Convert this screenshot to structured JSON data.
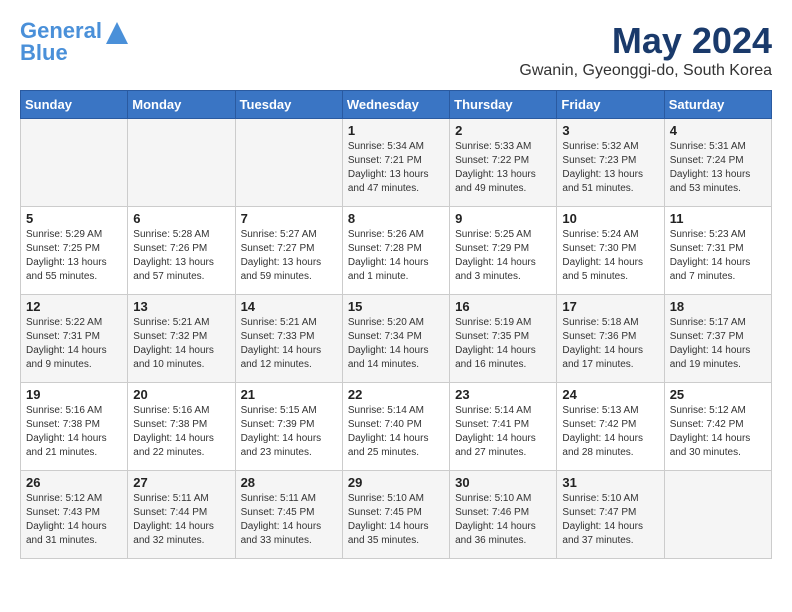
{
  "header": {
    "logo_line1": "General",
    "logo_line2": "Blue",
    "month": "May 2024",
    "location": "Gwanin, Gyeonggi-do, South Korea"
  },
  "days_of_week": [
    "Sunday",
    "Monday",
    "Tuesday",
    "Wednesday",
    "Thursday",
    "Friday",
    "Saturday"
  ],
  "weeks": [
    [
      {
        "day": "",
        "content": ""
      },
      {
        "day": "",
        "content": ""
      },
      {
        "day": "",
        "content": ""
      },
      {
        "day": "1",
        "content": "Sunrise: 5:34 AM\nSunset: 7:21 PM\nDaylight: 13 hours and 47 minutes."
      },
      {
        "day": "2",
        "content": "Sunrise: 5:33 AM\nSunset: 7:22 PM\nDaylight: 13 hours and 49 minutes."
      },
      {
        "day": "3",
        "content": "Sunrise: 5:32 AM\nSunset: 7:23 PM\nDaylight: 13 hours and 51 minutes."
      },
      {
        "day": "4",
        "content": "Sunrise: 5:31 AM\nSunset: 7:24 PM\nDaylight: 13 hours and 53 minutes."
      }
    ],
    [
      {
        "day": "5",
        "content": "Sunrise: 5:29 AM\nSunset: 7:25 PM\nDaylight: 13 hours and 55 minutes."
      },
      {
        "day": "6",
        "content": "Sunrise: 5:28 AM\nSunset: 7:26 PM\nDaylight: 13 hours and 57 minutes."
      },
      {
        "day": "7",
        "content": "Sunrise: 5:27 AM\nSunset: 7:27 PM\nDaylight: 13 hours and 59 minutes."
      },
      {
        "day": "8",
        "content": "Sunrise: 5:26 AM\nSunset: 7:28 PM\nDaylight: 14 hours and 1 minute."
      },
      {
        "day": "9",
        "content": "Sunrise: 5:25 AM\nSunset: 7:29 PM\nDaylight: 14 hours and 3 minutes."
      },
      {
        "day": "10",
        "content": "Sunrise: 5:24 AM\nSunset: 7:30 PM\nDaylight: 14 hours and 5 minutes."
      },
      {
        "day": "11",
        "content": "Sunrise: 5:23 AM\nSunset: 7:31 PM\nDaylight: 14 hours and 7 minutes."
      }
    ],
    [
      {
        "day": "12",
        "content": "Sunrise: 5:22 AM\nSunset: 7:31 PM\nDaylight: 14 hours and 9 minutes."
      },
      {
        "day": "13",
        "content": "Sunrise: 5:21 AM\nSunset: 7:32 PM\nDaylight: 14 hours and 10 minutes."
      },
      {
        "day": "14",
        "content": "Sunrise: 5:21 AM\nSunset: 7:33 PM\nDaylight: 14 hours and 12 minutes."
      },
      {
        "day": "15",
        "content": "Sunrise: 5:20 AM\nSunset: 7:34 PM\nDaylight: 14 hours and 14 minutes."
      },
      {
        "day": "16",
        "content": "Sunrise: 5:19 AM\nSunset: 7:35 PM\nDaylight: 14 hours and 16 minutes."
      },
      {
        "day": "17",
        "content": "Sunrise: 5:18 AM\nSunset: 7:36 PM\nDaylight: 14 hours and 17 minutes."
      },
      {
        "day": "18",
        "content": "Sunrise: 5:17 AM\nSunset: 7:37 PM\nDaylight: 14 hours and 19 minutes."
      }
    ],
    [
      {
        "day": "19",
        "content": "Sunrise: 5:16 AM\nSunset: 7:38 PM\nDaylight: 14 hours and 21 minutes."
      },
      {
        "day": "20",
        "content": "Sunrise: 5:16 AM\nSunset: 7:38 PM\nDaylight: 14 hours and 22 minutes."
      },
      {
        "day": "21",
        "content": "Sunrise: 5:15 AM\nSunset: 7:39 PM\nDaylight: 14 hours and 23 minutes."
      },
      {
        "day": "22",
        "content": "Sunrise: 5:14 AM\nSunset: 7:40 PM\nDaylight: 14 hours and 25 minutes."
      },
      {
        "day": "23",
        "content": "Sunrise: 5:14 AM\nSunset: 7:41 PM\nDaylight: 14 hours and 27 minutes."
      },
      {
        "day": "24",
        "content": "Sunrise: 5:13 AM\nSunset: 7:42 PM\nDaylight: 14 hours and 28 minutes."
      },
      {
        "day": "25",
        "content": "Sunrise: 5:12 AM\nSunset: 7:42 PM\nDaylight: 14 hours and 30 minutes."
      }
    ],
    [
      {
        "day": "26",
        "content": "Sunrise: 5:12 AM\nSunset: 7:43 PM\nDaylight: 14 hours and 31 minutes."
      },
      {
        "day": "27",
        "content": "Sunrise: 5:11 AM\nSunset: 7:44 PM\nDaylight: 14 hours and 32 minutes."
      },
      {
        "day": "28",
        "content": "Sunrise: 5:11 AM\nSunset: 7:45 PM\nDaylight: 14 hours and 33 minutes."
      },
      {
        "day": "29",
        "content": "Sunrise: 5:10 AM\nSunset: 7:45 PM\nDaylight: 14 hours and 35 minutes."
      },
      {
        "day": "30",
        "content": "Sunrise: 5:10 AM\nSunset: 7:46 PM\nDaylight: 14 hours and 36 minutes."
      },
      {
        "day": "31",
        "content": "Sunrise: 5:10 AM\nSunset: 7:47 PM\nDaylight: 14 hours and 37 minutes."
      },
      {
        "day": "",
        "content": ""
      }
    ]
  ]
}
